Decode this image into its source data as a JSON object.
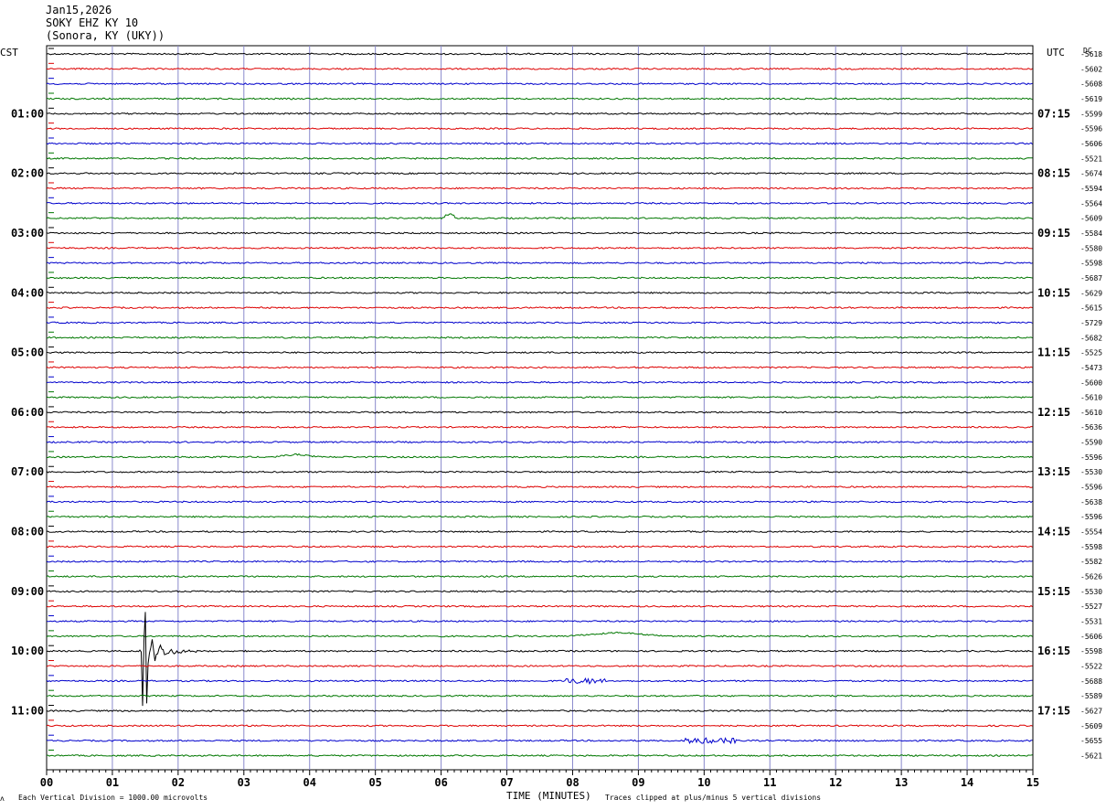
{
  "header": {
    "date": "Jan15,2026",
    "station": "SOKY EHZ KY 10",
    "location": "(Sonora, KY (UKY))"
  },
  "left_axis_title": "CST",
  "right_axis_title": "UTC",
  "dc_title": "DC",
  "footer": {
    "scale_note": "Each Vertical Division = 1000.00 microvolts",
    "x_title": "TIME (MINUTES)",
    "clip_note": "Traces clipped at plus/minus 5 vertical divisions",
    "corner_mark": "ʌ"
  },
  "colors": {
    "trace_cycle": [
      "#000000",
      "#dd0000",
      "#0000cc",
      "#007700"
    ],
    "minute_grid": "#8888cc"
  },
  "chart_data": {
    "type": "line",
    "description_type": "helicorder",
    "x_ticks": [
      "00",
      "01",
      "02",
      "03",
      "04",
      "05",
      "06",
      "07",
      "08",
      "09",
      "10",
      "11",
      "12",
      "13",
      "14",
      "15"
    ],
    "xlim": [
      0,
      15
    ],
    "row_minutes": 15,
    "rows": 48,
    "cst_labels": [
      "01:00",
      "02:00",
      "03:00",
      "04:00",
      "05:00",
      "06:00",
      "07:00",
      "08:00",
      "09:00",
      "10:00",
      "11:00"
    ],
    "utc_labels": [
      "07:15",
      "08:15",
      "09:15",
      "10:15",
      "11:15",
      "12:15",
      "13:15",
      "14:15",
      "15:15",
      "16:15",
      "17:15"
    ],
    "dc_offsets": [
      "-5618",
      "-5602",
      "-5608",
      "-5619",
      "-5599",
      "-5596",
      "-5606",
      "-5521",
      "-5674",
      "-5594",
      "-5564",
      "-5609",
      "-5584",
      "-5580",
      "-5598",
      "-5687",
      "-5629",
      "-5615",
      "-5729",
      "-5682",
      "-5525",
      "-5473",
      "-5600",
      "-5610",
      "-5610",
      "-5636",
      "-5590",
      "-5596",
      "-5530",
      "-5596",
      "-5638",
      "-5596",
      "-5554",
      "-5598",
      "-5582",
      "-5626",
      "-5530",
      "-5527",
      "-5531",
      "-5606",
      "-5598",
      "-5522",
      "-5688",
      "-5589",
      "-5627",
      "-5609",
      "-5655",
      "-5621"
    ],
    "events": [
      {
        "row": 11,
        "minute": 6.05,
        "amplitude": 4,
        "duration": 0.15,
        "kind": "step"
      },
      {
        "row": 27,
        "minute": 3.8,
        "amplitude": 3,
        "duration": 0.35,
        "kind": "drift"
      },
      {
        "row": 39,
        "minute": 8.7,
        "amplitude": 4,
        "duration": 0.8,
        "kind": "drift"
      },
      {
        "row": 40,
        "minute": 1.45,
        "amplitude": 80,
        "duration": 0.9,
        "kind": "quake"
      },
      {
        "row": 42,
        "minute": 8.2,
        "amplitude": 3,
        "duration": 0.6,
        "kind": "noise"
      },
      {
        "row": 46,
        "minute": 10.1,
        "amplitude": 3,
        "duration": 0.8,
        "kind": "noise"
      }
    ]
  }
}
